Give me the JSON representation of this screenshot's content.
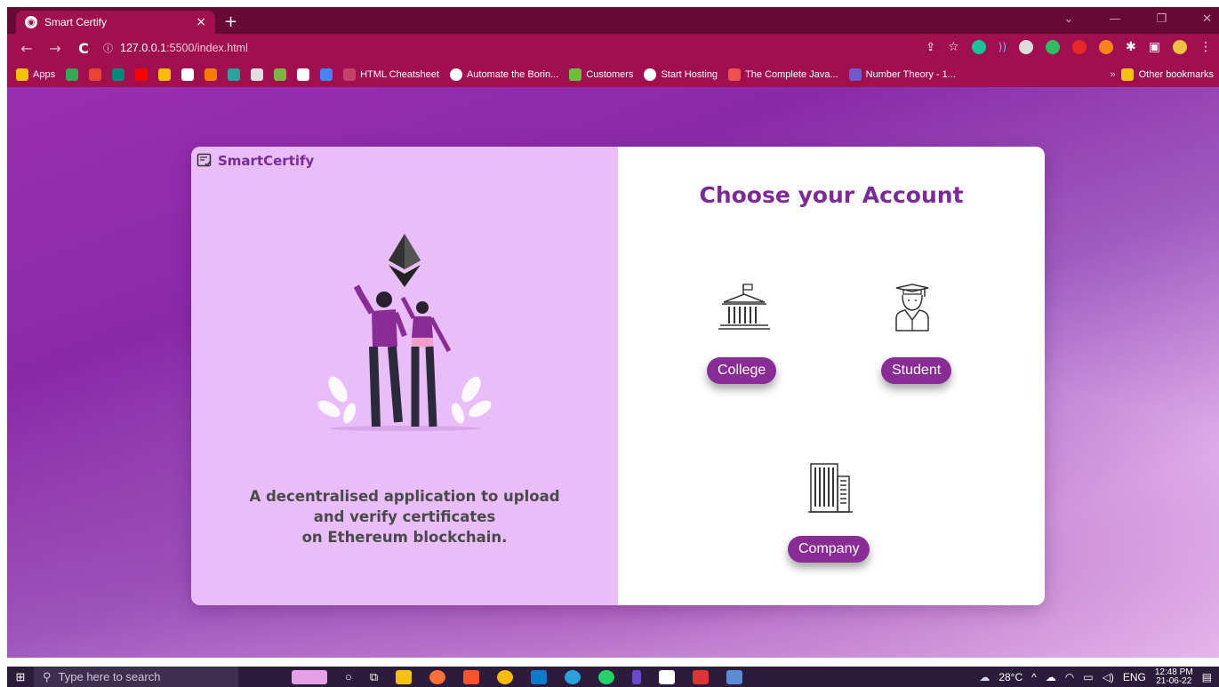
{
  "browser": {
    "tab_title": "Smart Certify",
    "url_host": "127.0.0.1",
    "url_path": ":5500/index.html",
    "bookmarks": [
      "Apps",
      "HTML Cheatsheet",
      "Automate the Borin...",
      "Customers",
      "Start Hosting",
      "The Complete Java...",
      "Number Theory - 1..."
    ],
    "other_bookmarks": "Other bookmarks"
  },
  "brand": {
    "name": "SmartCertify"
  },
  "left": {
    "tagline_1": "A decentralised application to upload",
    "tagline_2": "and verify certificates",
    "tagline_3": "on Ethereum blockchain."
  },
  "right": {
    "heading": "Choose your Account",
    "college_label": "College",
    "student_label": "Student",
    "company_label": "Company"
  },
  "taskbar": {
    "search_placeholder": "Type here to search",
    "weather": "28°C",
    "language": "ENG",
    "time": "12:48 PM",
    "date": "21-06-22"
  },
  "colors": {
    "accent": "#7b2a98",
    "button": "#8a2c96",
    "left_panel": "#e9bdf8",
    "chrome": "#a0104f"
  }
}
